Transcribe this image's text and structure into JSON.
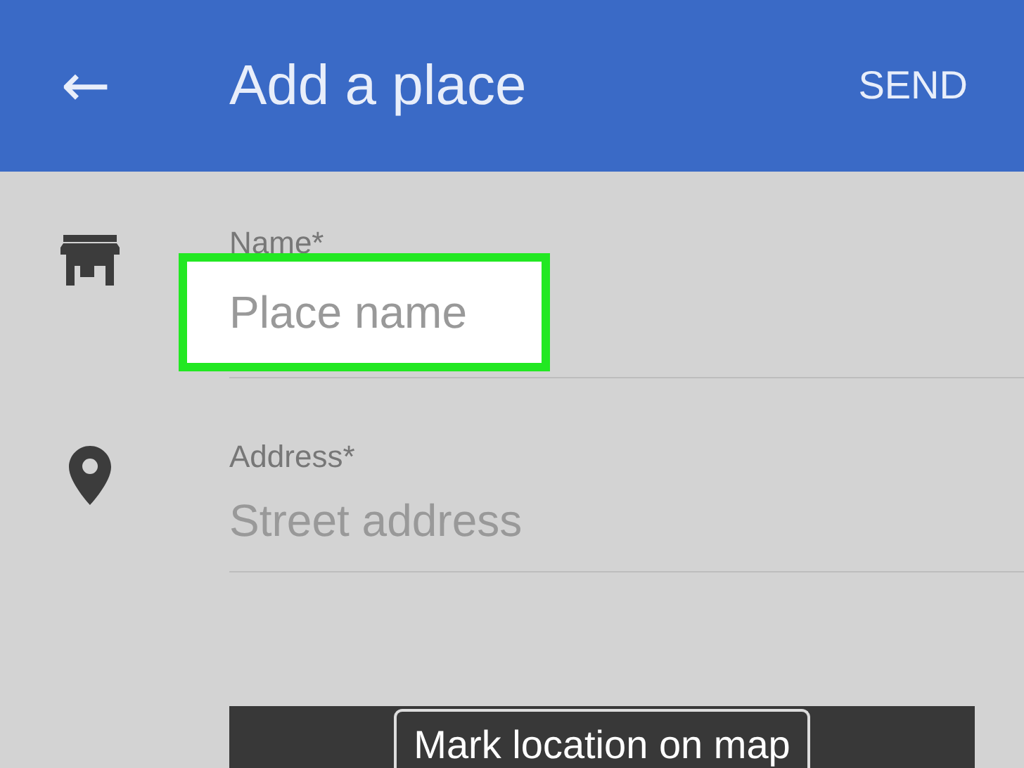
{
  "app_bar": {
    "back_icon": "←",
    "title": "Add a place",
    "action": "SEND"
  },
  "fields": [
    {
      "kind": "name",
      "label": "Name*",
      "placeholder": "Place name",
      "highlighted": true
    },
    {
      "kind": "address",
      "label": "Address*",
      "placeholder": "Street address",
      "highlighted": false
    }
  ],
  "map": {
    "button": "Mark location on map"
  }
}
